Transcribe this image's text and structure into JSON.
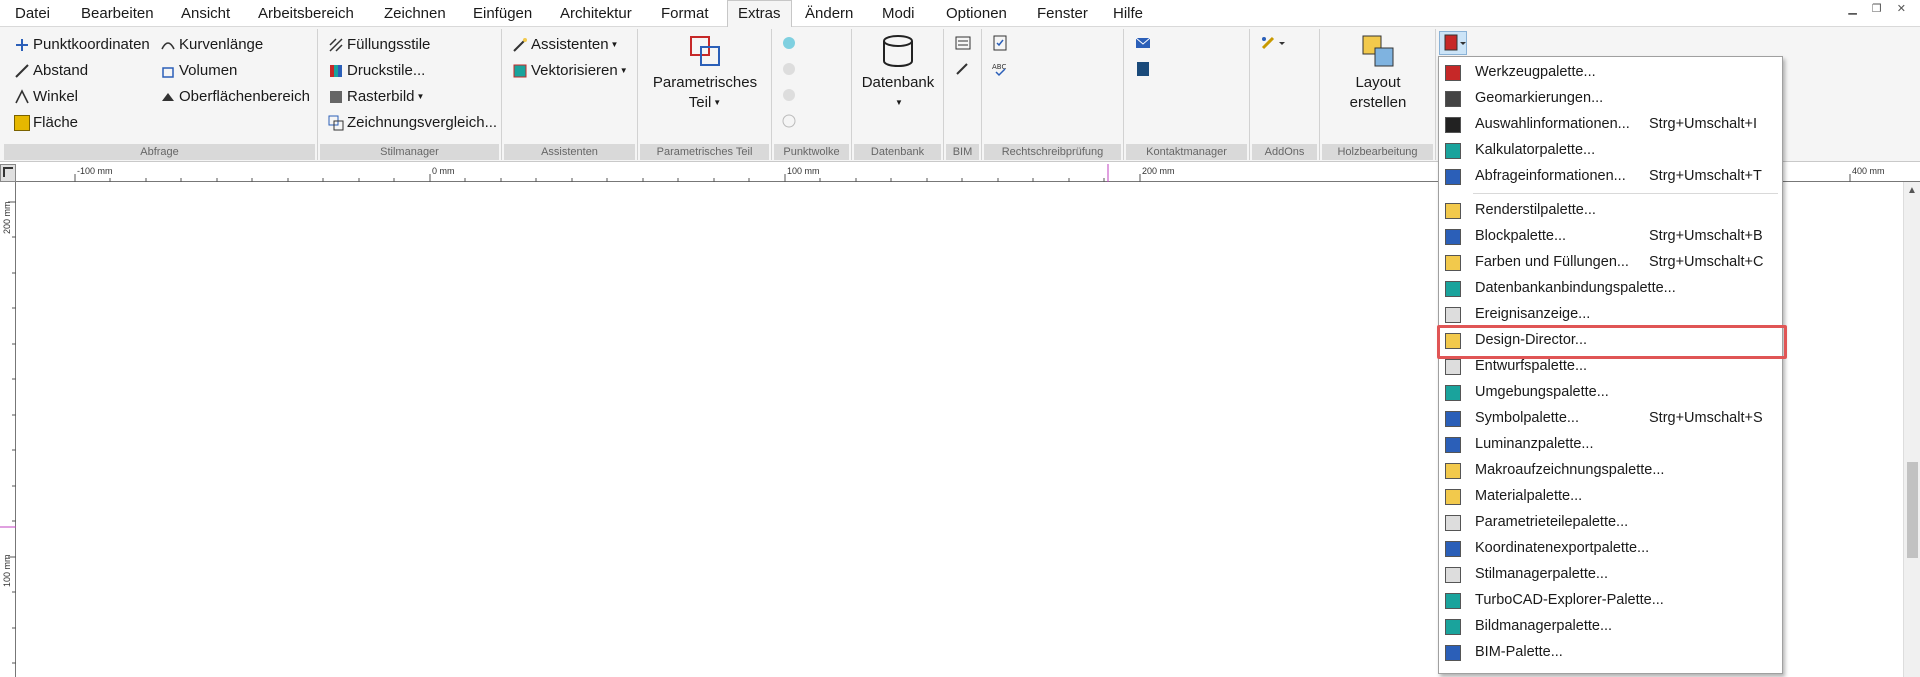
{
  "menubar": {
    "items": [
      "Datei",
      "Bearbeiten",
      "Ansicht",
      "Arbeitsbereich",
      "Zeichnen",
      "Einfügen",
      "Architektur",
      "Format",
      "Extras",
      "Ändern",
      "Modi",
      "Optionen",
      "Fenster",
      "Hilfe"
    ],
    "active": "Extras"
  },
  "ribbon": {
    "abfrage": {
      "label": "Abfrage",
      "punktkoordinaten": "Punktkoordinaten",
      "abstand": "Abstand",
      "winkel": "Winkel",
      "flaeche": "Fläche",
      "kurvenlaenge": "Kurvenlänge",
      "volumen": "Volumen",
      "oberflaechenbereich": "Oberflächenbereich"
    },
    "stilmanager": {
      "label": "Stilmanager",
      "fuellungsstile": "Füllungsstile",
      "druckstile": "Druckstile...",
      "rasterbild": "Rasterbild",
      "zeichnungsvergleich": "Zeichnungsvergleich..."
    },
    "assistenten": {
      "label": "Assistenten",
      "assistenten": "Assistenten",
      "vektorisieren": "Vektorisieren"
    },
    "parametrisches_teil": {
      "label": "Parametrisches Teil",
      "button_line1": "Parametrisches",
      "button_line2": "Teil"
    },
    "punktwolke": {
      "label": "Punktwolke"
    },
    "datenbank": {
      "label": "Datenbank",
      "button": "Datenbank"
    },
    "bim": {
      "label": "BIM"
    },
    "rechtschreibpruefung": {
      "label": "Rechtschreibprüfung"
    },
    "kontaktmanager": {
      "label": "Kontaktmanager"
    },
    "addons": {
      "label": "AddOns"
    },
    "holzbearbeitung": {
      "label": "Holzbearbeitung",
      "button_line1": "Layout",
      "button_line2": "erstellen"
    }
  },
  "rulers": {
    "h_labels": [
      "-100 mm",
      "0 mm",
      "100 mm",
      "200 mm",
      "400 mm"
    ],
    "v_labels": [
      "200 mm",
      "100 mm"
    ]
  },
  "dropdown": {
    "items": [
      {
        "label": "Werkzeugpalette...",
        "shortcut": "",
        "icon": "toolbox-icon",
        "color": "#c62828"
      },
      {
        "label": "Geomarkierungen...",
        "shortcut": "",
        "icon": "geomarker-icon",
        "color": "#444444"
      },
      {
        "label": "Auswahlinformationen...",
        "shortcut": "Strg+Umschalt+I",
        "icon": "cursor-icon",
        "color": "#222222"
      },
      {
        "label": "Kalkulatorpalette...",
        "shortcut": "",
        "icon": "calculator-icon",
        "color": "#1aa39c"
      },
      {
        "label": "Abfrageinformationen...",
        "shortcut": "Strg+Umschalt+T",
        "icon": "query-icon",
        "color": "#2b5fb8"
      },
      {
        "label": "Renderstilpalette...",
        "shortcut": "",
        "icon": "render-icon",
        "color": "#f2c94c"
      },
      {
        "label": "Blockpalette...",
        "shortcut": "Strg+Umschalt+B",
        "icon": "block-icon",
        "color": "#2b5fb8"
      },
      {
        "label": "Farben und Füllungen...",
        "shortcut": "Strg+Umschalt+C",
        "icon": "palette-icon",
        "color": "#f2c94c"
      },
      {
        "label": "Datenbankanbindungspalette...",
        "shortcut": "",
        "icon": "database-link-icon",
        "color": "#1aa39c"
      },
      {
        "label": "Ereignisanzeige...",
        "shortcut": "",
        "icon": "event-icon",
        "color": "#dddddd"
      },
      {
        "label": "Design-Director...",
        "shortcut": "",
        "icon": "design-director-icon",
        "color": "#f2c94c"
      },
      {
        "label": "Entwurfspalette...",
        "shortcut": "",
        "icon": "draft-icon",
        "color": "#dddddd"
      },
      {
        "label": "Umgebungspalette...",
        "shortcut": "",
        "icon": "environment-icon",
        "color": "#1aa39c"
      },
      {
        "label": "Symbolpalette...",
        "shortcut": "Strg+Umschalt+S",
        "icon": "symbol-icon",
        "color": "#2b5fb8"
      },
      {
        "label": "Luminanzpalette...",
        "shortcut": "",
        "icon": "luminance-icon",
        "color": "#2b5fb8"
      },
      {
        "label": "Makroaufzeichnungspalette...",
        "shortcut": "",
        "icon": "macro-icon",
        "color": "#f2c94c"
      },
      {
        "label": "Materialpalette...",
        "shortcut": "",
        "icon": "material-icon",
        "color": "#f2c94c"
      },
      {
        "label": "Parametrieteilepalette...",
        "shortcut": "",
        "icon": "parametric-icon",
        "color": "#dddddd"
      },
      {
        "label": "Koordinatenexportpalette...",
        "shortcut": "",
        "icon": "coordinate-export-icon",
        "color": "#2b5fb8"
      },
      {
        "label": "Stilmanagerpalette...",
        "shortcut": "",
        "icon": "style-manager-icon",
        "color": "#dddddd"
      },
      {
        "label": "TurboCAD-Explorer-Palette...",
        "shortcut": "",
        "icon": "explorer-icon",
        "color": "#1aa39c"
      },
      {
        "label": "Bildmanagerpalette...",
        "shortcut": "",
        "icon": "image-manager-icon",
        "color": "#1aa39c"
      },
      {
        "label": "BIM-Palette...",
        "shortcut": "",
        "icon": "bim-icon",
        "color": "#2b5fb8"
      }
    ],
    "highlighted": "Design-Director..."
  }
}
